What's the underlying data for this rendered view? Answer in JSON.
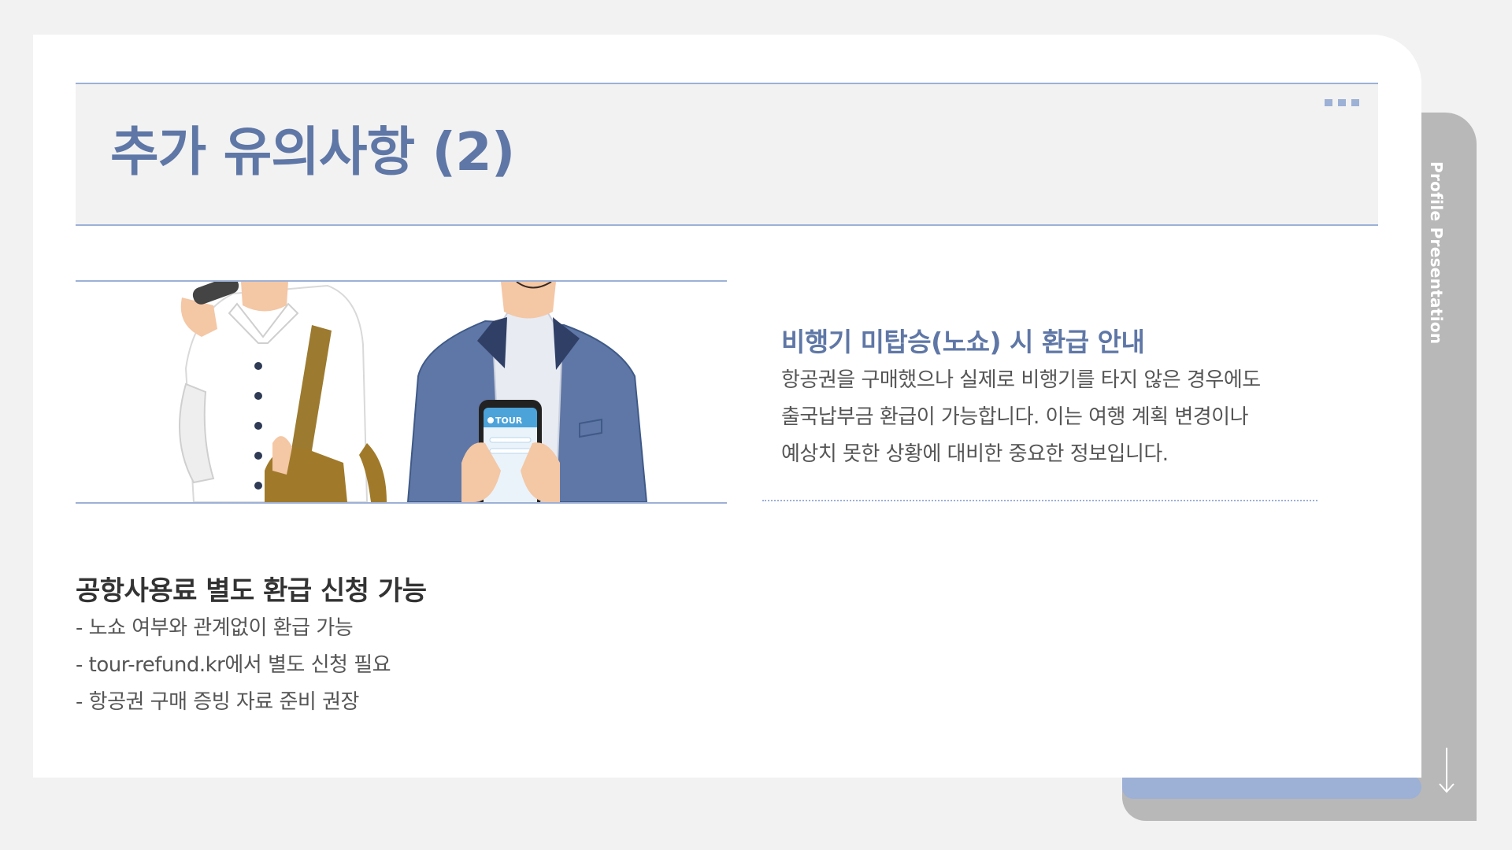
{
  "side_tab": {
    "label": "Profile Presentation"
  },
  "slide": {
    "title": "추가 유의사항 (2)",
    "info": {
      "heading": "비행기 미탑승(노쇼) 시 환급 안내",
      "lines": [
        "항공권을 구매했으나 실제로 비행기를 타지 않은 경우에도",
        "출국납부금 환급이 가능합니다. 이는 여행 계획 변경이나",
        "예상치 못한 상황에 대비한 중요한 정보입니다."
      ]
    },
    "airport_fee": {
      "heading": "공항사용료 별도 환급 신청 가능",
      "bullets": [
        "- 노쇼 여부와 관계없이 환급 가능",
        "- tour-refund.kr에서 별도 신청 필요",
        "- 항공권 구매 증빙 자료 준비 권장"
      ]
    },
    "illustration": {
      "phone_brand": "TOUR"
    }
  },
  "colors": {
    "accent": "#5f77a6",
    "accent_light": "#9db0d6",
    "tab_gray": "#b8b8b8",
    "background": "#f2f2f2"
  },
  "icons": {
    "menu": "more-dots-icon",
    "scroll": "arrow-down-icon"
  }
}
